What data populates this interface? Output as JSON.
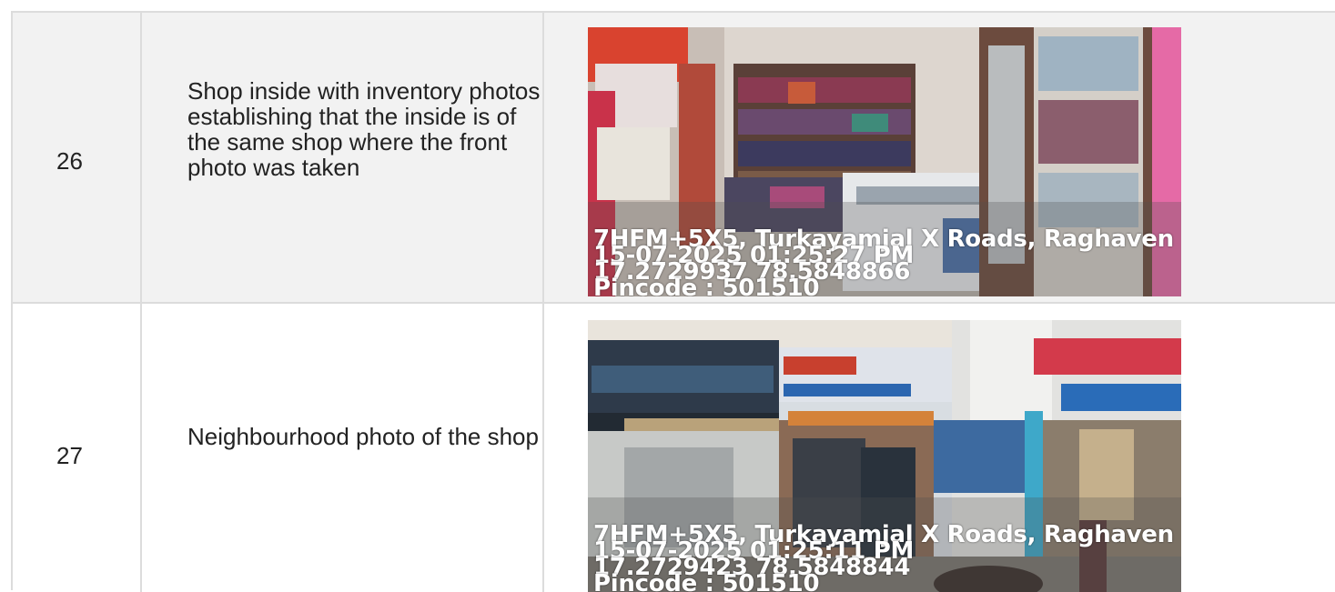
{
  "rows": [
    {
      "number": "26",
      "description": "Shop inside with inventory photos establishing that the inside is of the same shop where the front photo was taken",
      "photo": {
        "subject": "shop-interior",
        "stamp": {
          "address": "7HFM+5X5, Turkayamjal X Roads, Raghaven",
          "datetime": "15-07-2025 01:25:27 PM",
          "coords": "17.2729937 78.5848866",
          "pincode": "Pincode : 501510"
        }
      }
    },
    {
      "number": "27",
      "description": "Neighbourhood photo of the shop",
      "photo": {
        "subject": "street-view",
        "stamp": {
          "address": "7HFM+5X5, Turkayamjal X Roads, Raghaven",
          "datetime": "15-07-2025 01:25:11 PM",
          "coords": "17.2729423 78.5848844",
          "pincode": "Pincode : 501510"
        }
      }
    }
  ],
  "colors": {
    "border": "#dcdcdc",
    "row_alt_background": "#f2f2f2",
    "text": "#222222"
  }
}
